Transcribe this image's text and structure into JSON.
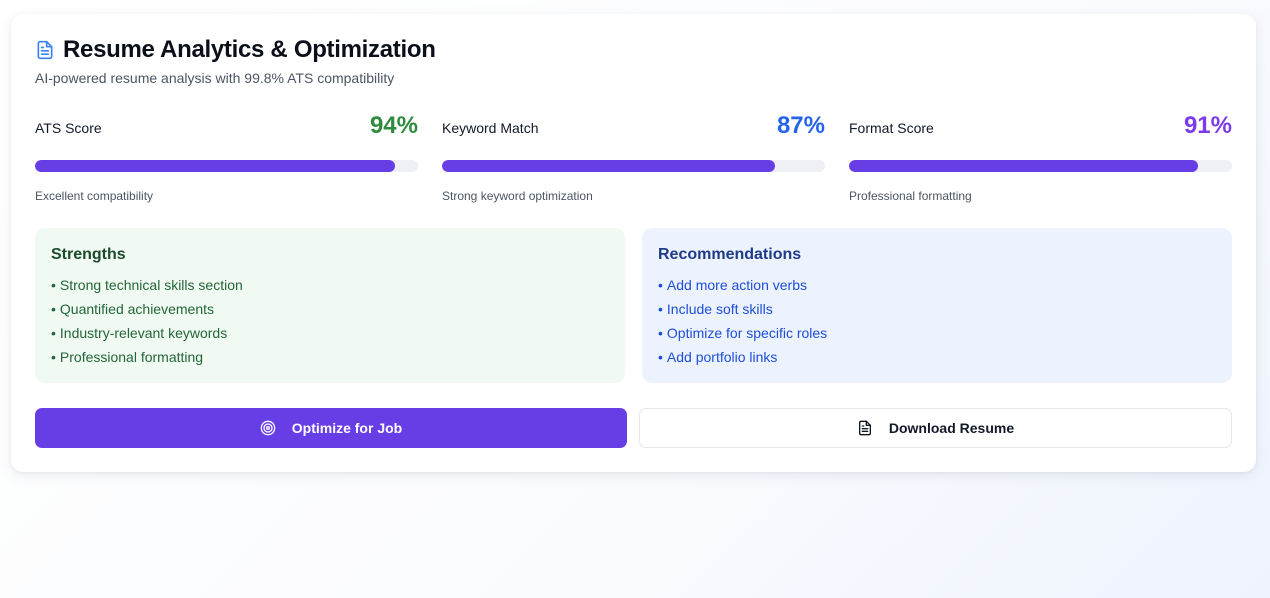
{
  "header": {
    "title": "Resume Analytics & Optimization",
    "subtitle": "AI-powered resume analysis with 99.8% ATS compatibility",
    "icon": "document-icon"
  },
  "metrics": [
    {
      "label": "ATS Score",
      "value": "94%",
      "progress_percent": 94,
      "caption": "Excellent compatibility",
      "value_color": "#2e8b3e"
    },
    {
      "label": "Keyword Match",
      "value": "87%",
      "progress_percent": 87,
      "caption": "Strong keyword optimization",
      "value_color": "#2563eb"
    },
    {
      "label": "Format Score",
      "value": "91%",
      "progress_percent": 91,
      "caption": "Professional formatting",
      "value_color": "#7c3aed"
    }
  ],
  "strengths": {
    "title": "Strengths",
    "items": [
      "Strong technical skills section",
      "Quantified achievements",
      "Industry-relevant keywords",
      "Professional formatting"
    ]
  },
  "recommendations": {
    "title": "Recommendations",
    "items": [
      "Add more action verbs",
      "Include soft skills",
      "Optimize for specific roles",
      "Add portfolio links"
    ]
  },
  "actions": {
    "optimize_label": "Optimize for Job",
    "optimize_icon": "target-icon",
    "download_label": "Download Resume",
    "download_icon": "document-icon"
  },
  "colors": {
    "accent": "#673de6",
    "bar_track": "#eef0f5",
    "strengths_bg": "#f0f9f2",
    "recommendations_bg": "#edf3fe"
  }
}
